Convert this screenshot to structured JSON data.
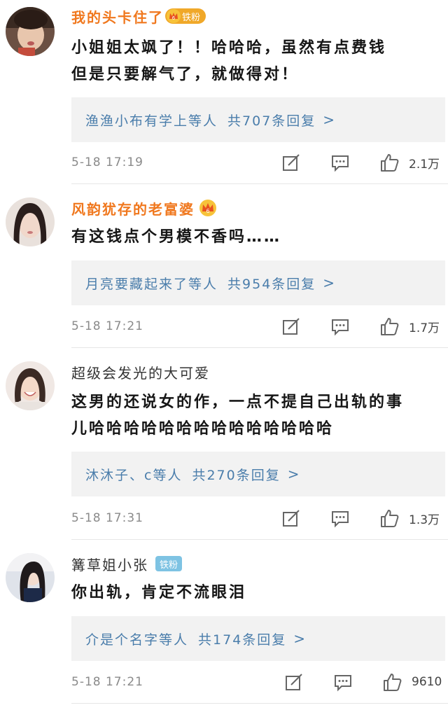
{
  "comments": [
    {
      "username": "我的头卡住了",
      "badge": "铁粉",
      "text_lines": [
        "小姐姐太飒了！！哈哈哈，虽然有点费钱",
        "但是只要解气了，就做得对！"
      ],
      "replies_users": "渔渔小布有学上等人",
      "replies_count": "共707条回复",
      "time": "5-18 17:19",
      "likes": "2.1万"
    },
    {
      "username": "风韵犹存的老富婆",
      "text_lines": [
        "有这钱点个男模不香吗……"
      ],
      "replies_users": "月亮要藏起来了等人",
      "replies_count": "共954条回复",
      "time": "5-18 17:21",
      "likes": "1.7万"
    },
    {
      "username": "超级会发光的大可爱",
      "text_lines": [
        "这男的还说女的作，一点不提自己出轨的事",
        "儿哈哈哈哈哈哈哈哈哈哈哈哈哈哈"
      ],
      "replies_users": "沐沐子、c等人",
      "replies_count": "共270条回复",
      "time": "5-18 17:31",
      "likes": "1.3万"
    },
    {
      "username": "篝草姐小张",
      "badge": "铁粉",
      "text_lines": [
        "你出轨，肯定不流眼泪"
      ],
      "replies_users": "介是个名字等人",
      "replies_count": "共174条回复",
      "time": "5-18 17:21",
      "likes": "9610"
    }
  ],
  "icons": {
    "edit": "edit-icon",
    "comment": "comment-icon",
    "like": "like-icon",
    "chevron": "chevron-right-icon",
    "crown": "crown-icon"
  },
  "colors": {
    "vip_name": "#f0781e",
    "link": "#4a7dab",
    "badge_blue": "#7ec3e3",
    "badge_gold": "#f0a829"
  }
}
